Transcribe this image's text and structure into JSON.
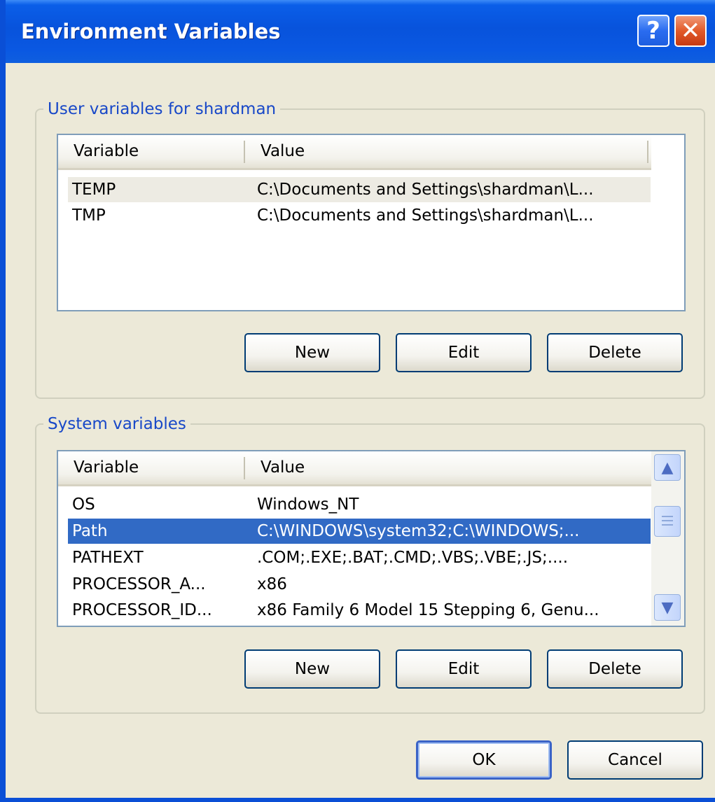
{
  "window": {
    "title": "Environment Variables"
  },
  "titlebar": {
    "help_symbol": "?",
    "close_symbol": "✕"
  },
  "user_vars": {
    "legend": "User variables for shardman",
    "headers": [
      "Variable",
      "Value"
    ],
    "rows": [
      {
        "variable": "TEMP",
        "value": "C:\\Documents and Settings\\shardman\\L..."
      },
      {
        "variable": "TMP",
        "value": "C:\\Documents and Settings\\shardman\\L..."
      }
    ],
    "buttons": {
      "new": "New",
      "edit": "Edit",
      "delete": "Delete"
    }
  },
  "system_vars": {
    "legend": "System variables",
    "headers": [
      "Variable",
      "Value"
    ],
    "rows": [
      {
        "variable": "OS",
        "value": "Windows_NT"
      },
      {
        "variable": "Path",
        "value": "C:\\WINDOWS\\system32;C:\\WINDOWS;..."
      },
      {
        "variable": "PATHEXT",
        "value": ".COM;.EXE;.BAT;.CMD;.VBS;.VBE;.JS;...."
      },
      {
        "variable": "PROCESSOR_A...",
        "value": "x86"
      },
      {
        "variable": "PROCESSOR_ID...",
        "value": "x86 Family 6 Model 15 Stepping 6, Genu..."
      }
    ],
    "selected_row": "Path",
    "buttons": {
      "new": "New",
      "edit": "Edit",
      "delete": "Delete"
    }
  },
  "footer": {
    "ok": "OK",
    "cancel": "Cancel"
  },
  "colors": {
    "titlebar": "#0853dc",
    "selection": "#316ac5",
    "legend": "#1848c8"
  },
  "icons": {
    "scroll_up": "▲",
    "scroll_down": "▼"
  }
}
